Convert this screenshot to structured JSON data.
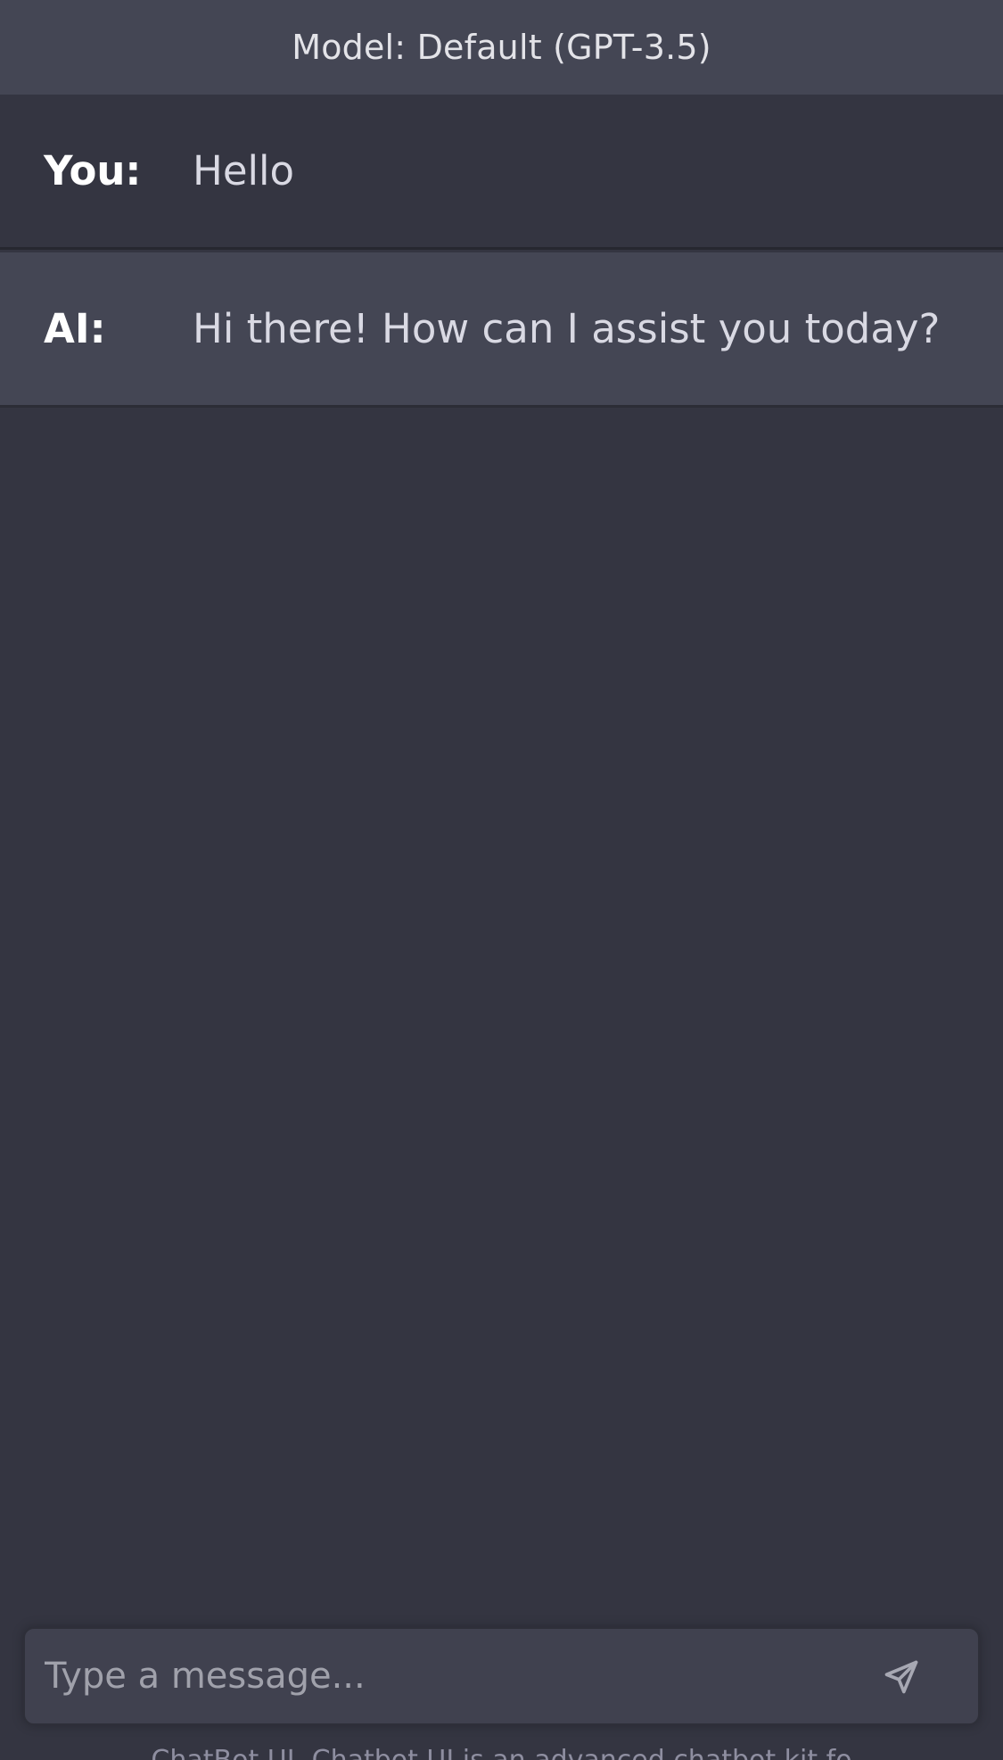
{
  "header": {
    "model_label": "Model: Default (GPT-3.5)"
  },
  "messages": [
    {
      "sender": "You:",
      "text": "Hello"
    },
    {
      "sender": "AI:",
      "text": "Hi there! How can I assist you today?"
    }
  ],
  "composer": {
    "placeholder": "Type a message...",
    "send_icon": "paper-plane-icon"
  },
  "footer": {
    "text": "ChatBot UI. Chatbot UI is an advanced chatbot kit fo"
  },
  "colors": {
    "background": "#343541",
    "header_bg": "#444654",
    "ai_message_bg": "#444654",
    "composer_bg": "#40414f"
  }
}
